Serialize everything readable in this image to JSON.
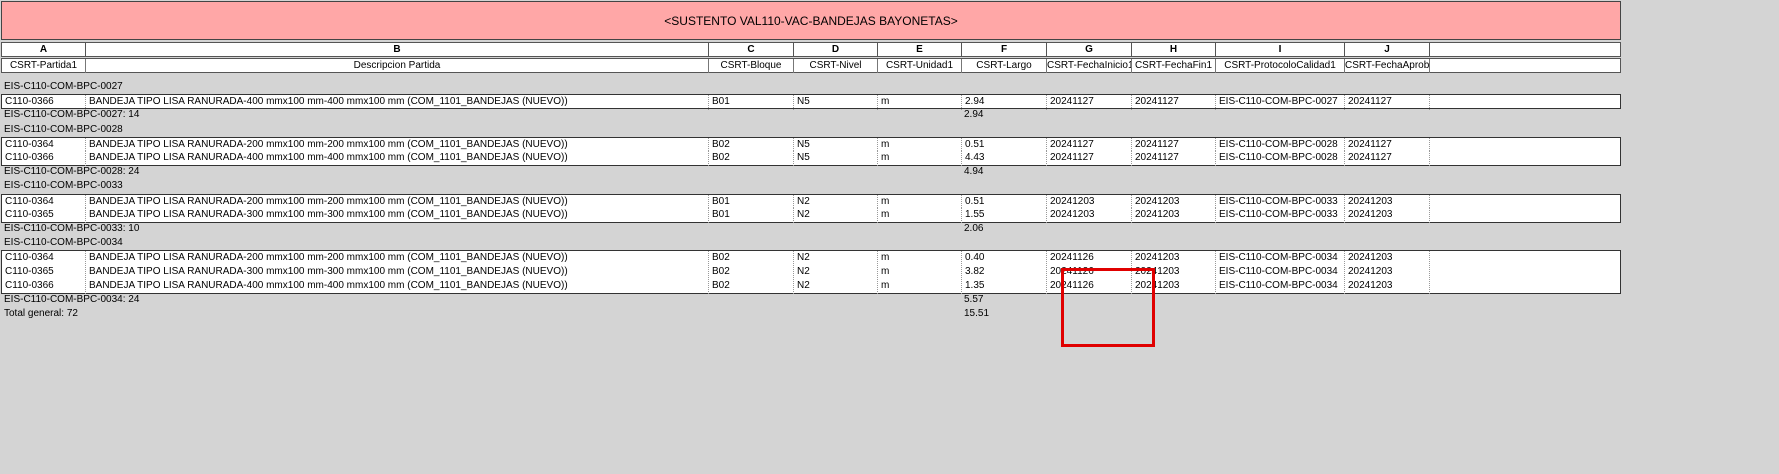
{
  "title": "<SUSTENTO VAL110-VAC-BANDEJAS BAYONETAS>",
  "column_letters": [
    "A",
    "B",
    "C",
    "D",
    "E",
    "F",
    "G",
    "H",
    "I",
    "J"
  ],
  "column_fields": [
    "CSRT-Partida1",
    "Descripcion Partida",
    "CSRT-Bloque",
    "CSRT-Nivel",
    "CSRT-Unidad1",
    "CSRT-Largo",
    "CSRT-FechaInicio1",
    "CSRT-FechaFin1",
    "CSRT-ProtocoloCalidad1",
    "CSRT-FechaAprob"
  ],
  "groups": [
    {
      "name": "EIS-C110-COM-BPC-0027",
      "rows": [
        [
          "C110-0366",
          "BANDEJA TIPO LISA RANURADA-400 mmx100 mm-400 mmx100 mm (COM_1101_BANDEJAS (NUEVO))",
          "B01",
          "N5",
          "m",
          "2.94",
          "20241127",
          "20241127",
          "EIS-C110-COM-BPC-0027",
          "20241127"
        ]
      ],
      "subtotal_label": "EIS-C110-COM-BPC-0027: 14",
      "subtotal_value": "2.94"
    },
    {
      "name": "EIS-C110-COM-BPC-0028",
      "rows": [
        [
          "C110-0364",
          "BANDEJA TIPO LISA RANURADA-200 mmx100 mm-200 mmx100 mm (COM_1101_BANDEJAS (NUEVO))",
          "B02",
          "N5",
          "m",
          "0.51",
          "20241127",
          "20241127",
          "EIS-C110-COM-BPC-0028",
          "20241127"
        ],
        [
          "C110-0366",
          "BANDEJA TIPO LISA RANURADA-400 mmx100 mm-400 mmx100 mm (COM_1101_BANDEJAS (NUEVO))",
          "B02",
          "N5",
          "m",
          "4.43",
          "20241127",
          "20241127",
          "EIS-C110-COM-BPC-0028",
          "20241127"
        ]
      ],
      "subtotal_label": "EIS-C110-COM-BPC-0028: 24",
      "subtotal_value": "4.94"
    },
    {
      "name": "EIS-C110-COM-BPC-0033",
      "rows": [
        [
          "C110-0364",
          "BANDEJA TIPO LISA RANURADA-200 mmx100 mm-200 mmx100 mm (COM_1101_BANDEJAS (NUEVO))",
          "B01",
          "N2",
          "m",
          "0.51",
          "20241203",
          "20241203",
          "EIS-C110-COM-BPC-0033",
          "20241203"
        ],
        [
          "C110-0365",
          "BANDEJA TIPO LISA RANURADA-300 mmx100 mm-300 mmx100 mm (COM_1101_BANDEJAS (NUEVO))",
          "B01",
          "N2",
          "m",
          "1.55",
          "20241203",
          "20241203",
          "EIS-C110-COM-BPC-0033",
          "20241203"
        ]
      ],
      "subtotal_label": "EIS-C110-COM-BPC-0033: 10",
      "subtotal_value": "2.06"
    },
    {
      "name": "EIS-C110-COM-BPC-0034",
      "rows": [
        [
          "C110-0364",
          "BANDEJA TIPO LISA RANURADA-200 mmx100 mm-200 mmx100 mm (COM_1101_BANDEJAS (NUEVO))",
          "B02",
          "N2",
          "m",
          "0.40",
          "20241126",
          "20241203",
          "EIS-C110-COM-BPC-0034",
          "20241203"
        ],
        [
          "C110-0365",
          "BANDEJA TIPO LISA RANURADA-300 mmx100 mm-300 mmx100 mm (COM_1101_BANDEJAS (NUEVO))",
          "B02",
          "N2",
          "m",
          "3.82",
          "20241126",
          "20241203",
          "EIS-C110-COM-BPC-0034",
          "20241203"
        ],
        [
          "C110-0366",
          "BANDEJA TIPO LISA RANURADA-400 mmx100 mm-400 mmx100 mm (COM_1101_BANDEJAS (NUEVO))",
          "B02",
          "N2",
          "m",
          "1.35",
          "20241126",
          "20241203",
          "EIS-C110-COM-BPC-0034",
          "20241203"
        ]
      ],
      "subtotal_label": "EIS-C110-COM-BPC-0034: 24",
      "subtotal_value": "5.57"
    }
  ],
  "total_label": "Total general: 72",
  "total_value": "15.51",
  "colors": {
    "title_bg": "#ffa7a7",
    "highlight": "#e00000",
    "background": "#d4d4d4"
  }
}
